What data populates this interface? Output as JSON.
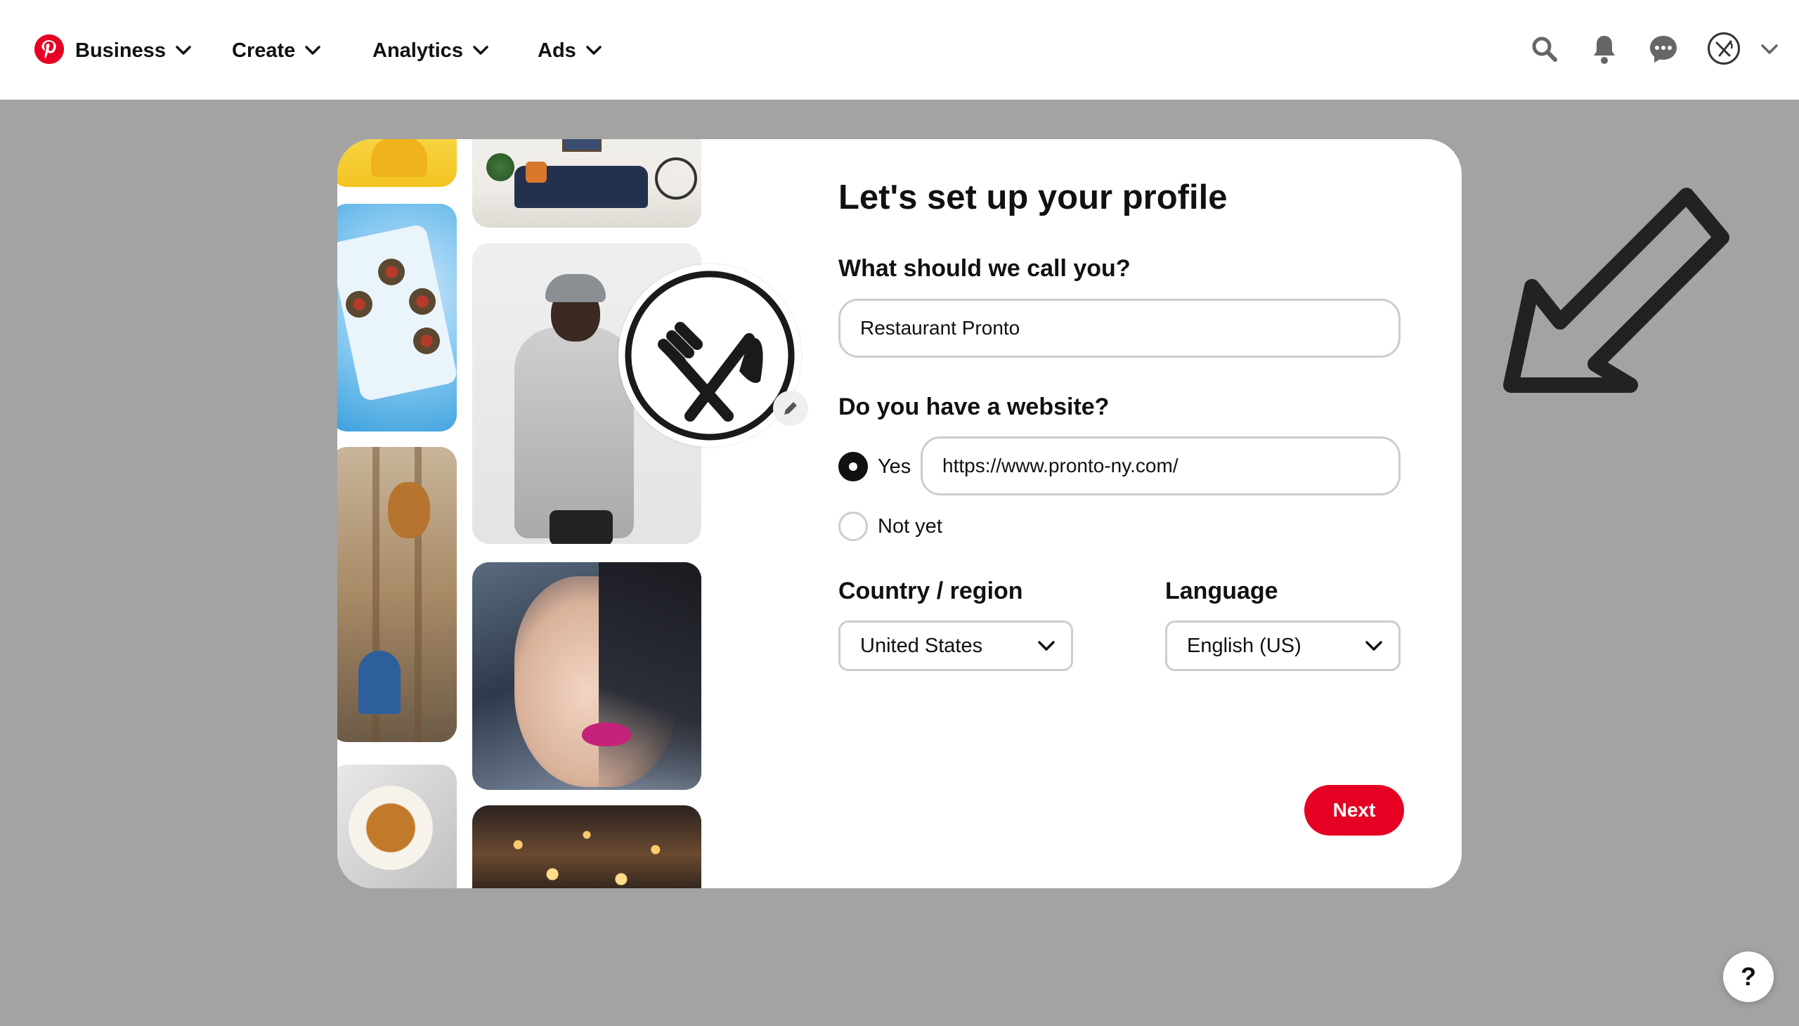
{
  "nav": {
    "logo_icon": "pinterest-logo-icon",
    "items": [
      {
        "label": "Business"
      },
      {
        "label": "Create"
      },
      {
        "label": "Analytics"
      },
      {
        "label": "Ads"
      }
    ],
    "icons": [
      "search-icon",
      "bell-icon",
      "messages-icon",
      "avatar-icon",
      "chevron-down-icon"
    ]
  },
  "form": {
    "title": "Let's set up your profile",
    "name_label": "What should we call you?",
    "name_value": "Restaurant Pronto",
    "website_label": "Do you have a website?",
    "yes_label": "Yes",
    "website_value": "https://www.pronto-ny.com/",
    "not_yet_label": "Not yet",
    "website_choice": "Yes",
    "country_label": "Country / region",
    "country_value": "United States",
    "language_label": "Language",
    "language_value": "English (US)",
    "next_label": "Next"
  },
  "help_label": "?",
  "colors": {
    "brand": "#e60023",
    "overlay": "#a3a3a3",
    "border": "#cdcdcd"
  }
}
